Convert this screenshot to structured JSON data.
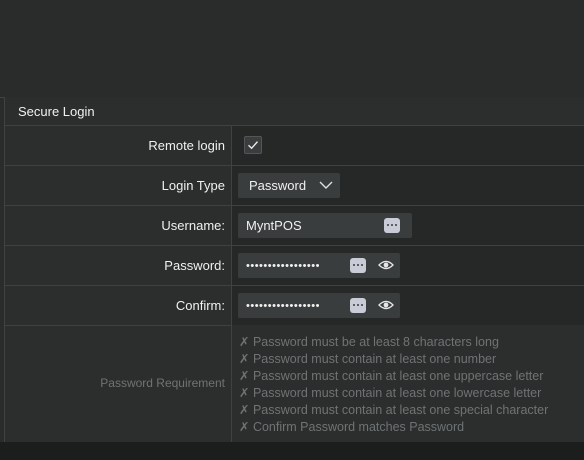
{
  "section_title": "Secure Login",
  "remote_login": {
    "label": "Remote login",
    "checked": true
  },
  "login_type": {
    "label": "Login Type",
    "value": "Password"
  },
  "username": {
    "label": "Username:",
    "value": "MyntPOS"
  },
  "password": {
    "label": "Password:",
    "value": "•••••••••••••••••"
  },
  "confirm": {
    "label": "Confirm:",
    "value": "•••••••••••••••••"
  },
  "requirements": {
    "label": "Password Requirement",
    "items": [
      "✗ Password must be at least 8 characters long",
      "✗ Password must contain at least one number",
      "✗ Password must contain at least one uppercase letter",
      "✗ Password must contain at least one lowercase letter",
      "✗ Password must contain at least one special character",
      "✗ Confirm Password matches Password"
    ]
  },
  "icons": {
    "check": "checkmark-icon",
    "chevron": "chevron-down-icon",
    "more": "more-dots-icon",
    "eye": "eye-icon"
  },
  "colors": {
    "background": "#2a2c2c",
    "field": "#3a3d3d",
    "border": "#3f4242",
    "muted_text": "#6f7373"
  }
}
